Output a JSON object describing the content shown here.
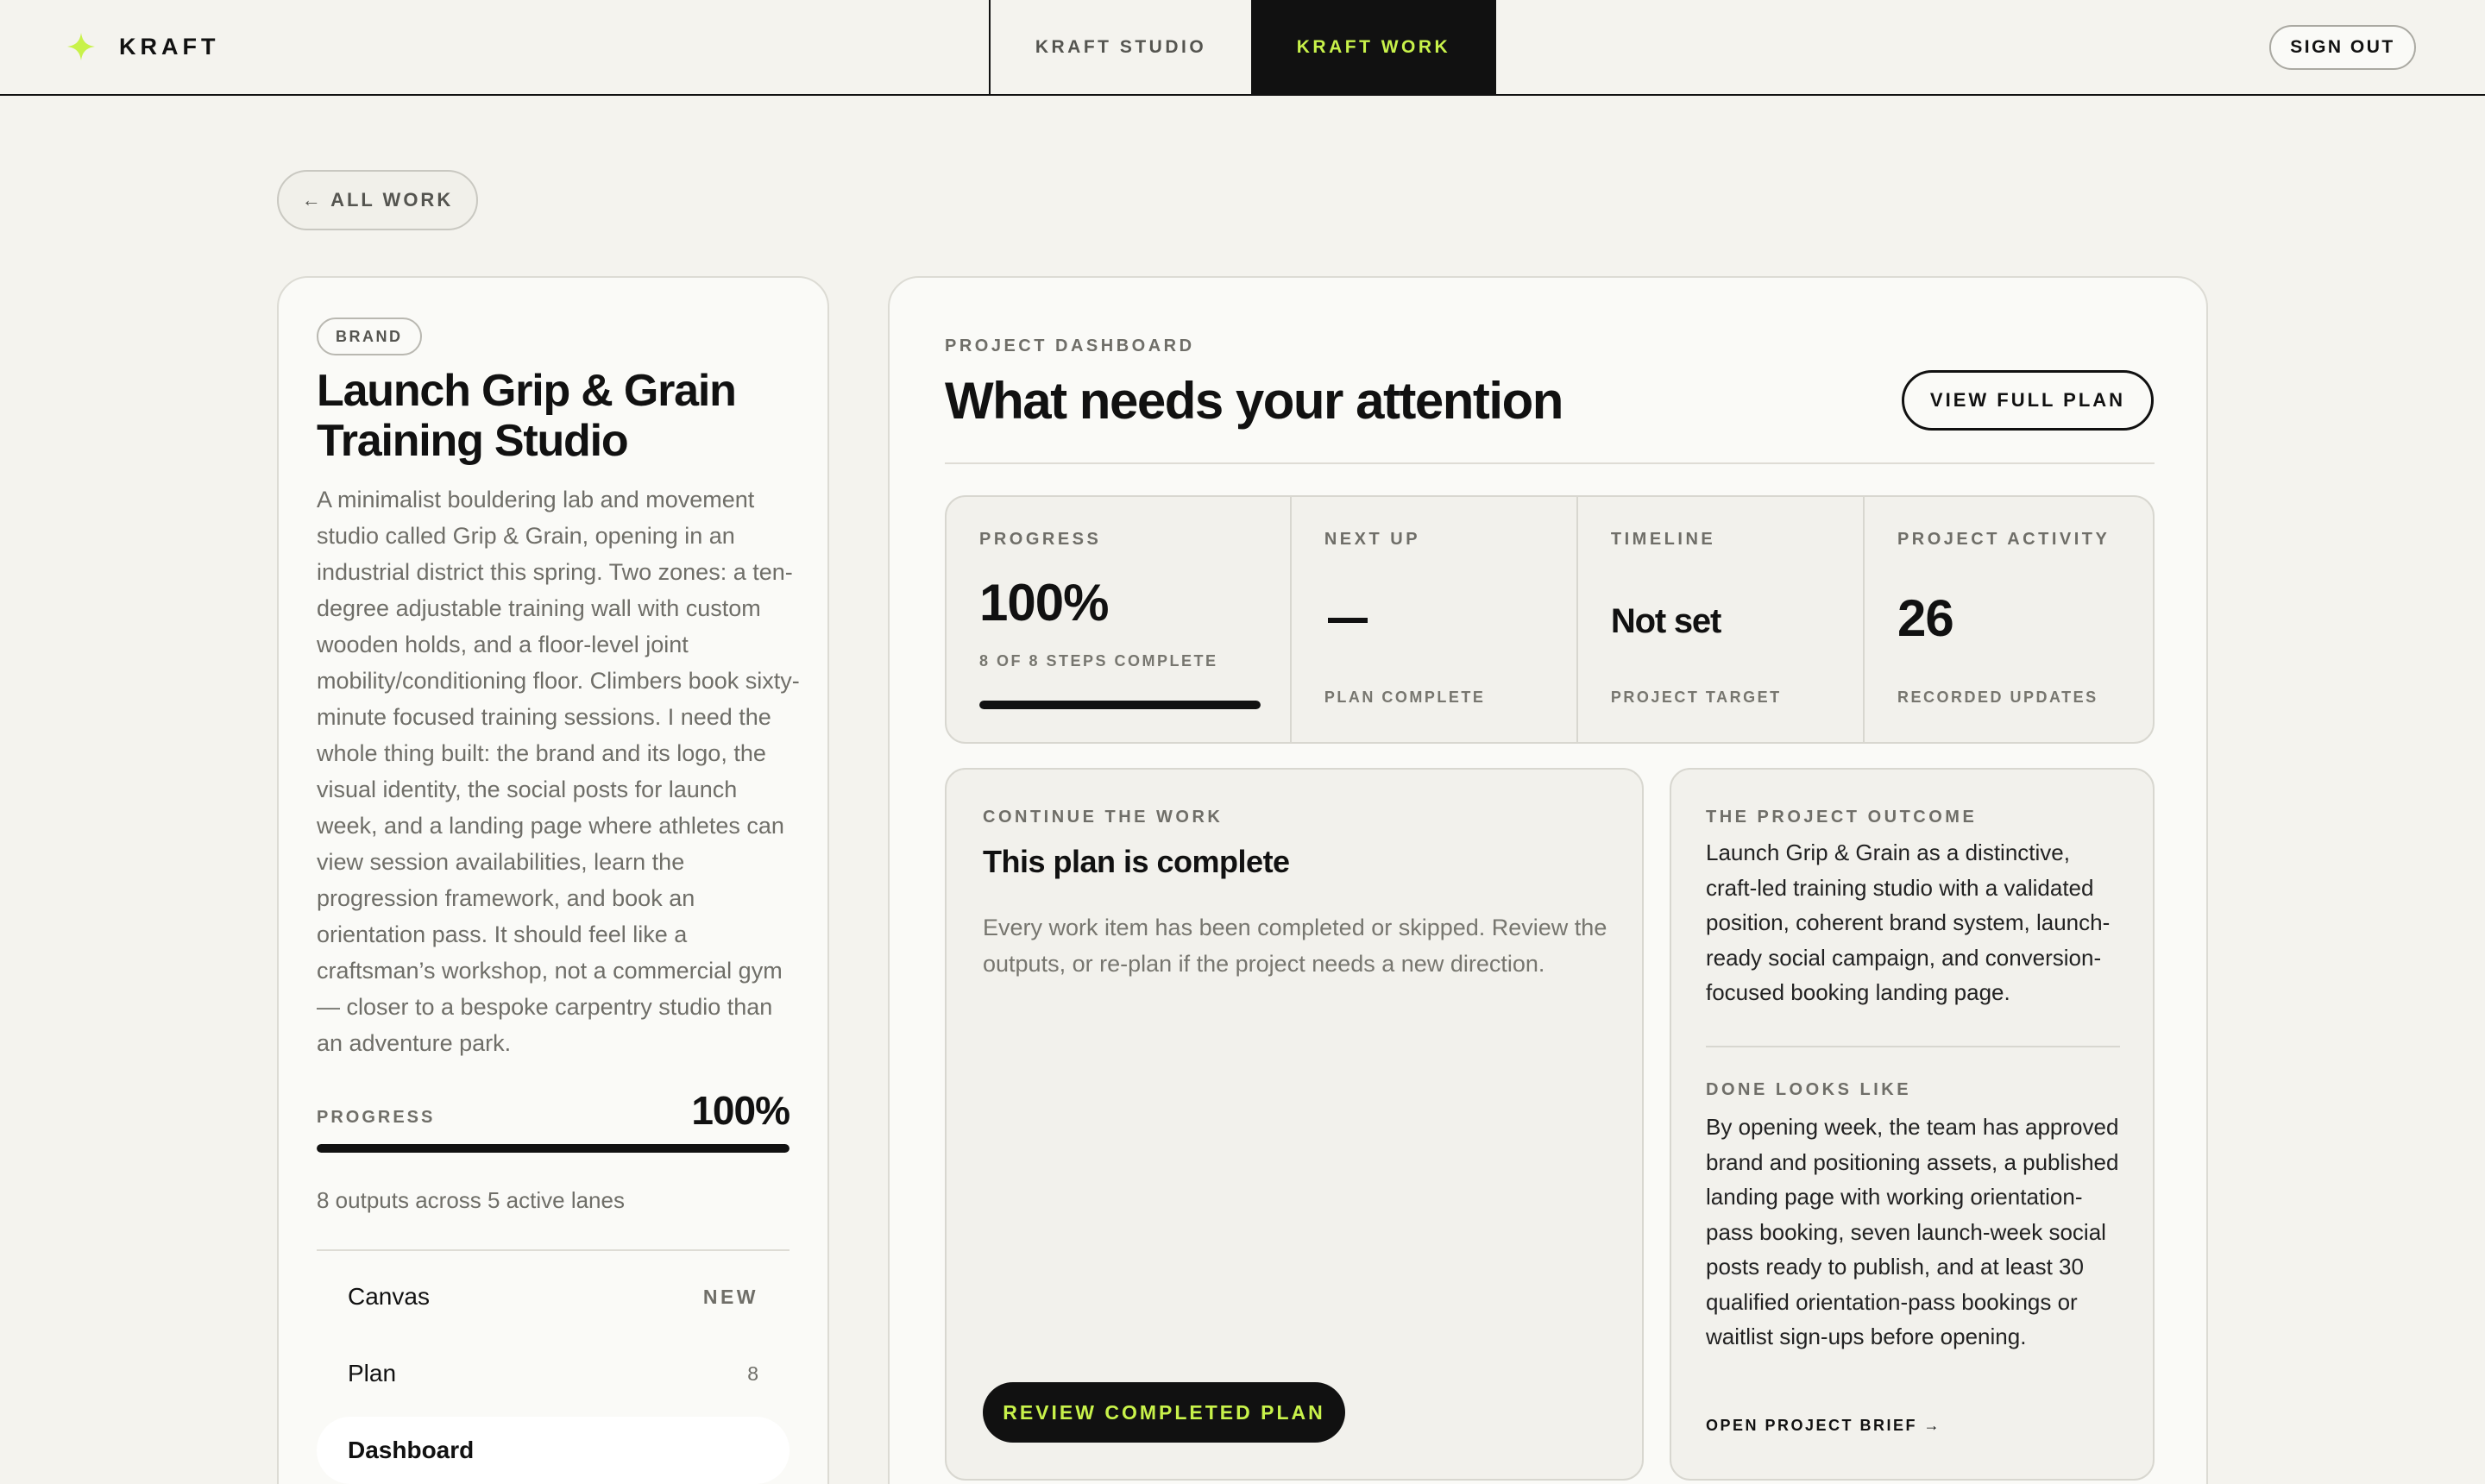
{
  "header": {
    "brand_name": "KRAFT",
    "nav": {
      "studio": "KRAFT STUDIO",
      "work": "KRAFT WORK"
    },
    "sign_out": "SIGN OUT",
    "accent_color": "#c8f24a"
  },
  "back_button": "← ALL WORK",
  "project": {
    "tag": "BRAND",
    "title": "Launch Grip & Grain Training Studio",
    "description": "A minimalist bouldering lab and movement studio called Grip & Grain, opening in an industrial district this spring. Two zones: a ten-degree adjustable training wall with custom wooden holds, and a floor-level joint mobility/conditioning floor. Climbers book sixty-minute focused training sessions. I need the whole thing built: the brand and its logo, the visual identity, the social posts for launch week, and a landing page where athletes can view session availabilities, learn the progression framework, and book an orientation pass. It should feel like a craftsman’s workshop, not a commercial gym — closer to a bespoke carpentry studio than an adventure park.",
    "progress_label": "PROGRESS",
    "progress_text": "100%",
    "progress_fraction": 1.0,
    "outputs_summary": "8 outputs across 5 active lanes",
    "lanes": [
      {
        "label": "Canvas",
        "meta": "NEW"
      },
      {
        "label": "Plan",
        "meta": "8"
      },
      {
        "label": "Dashboard",
        "meta": ""
      }
    ]
  },
  "dashboard": {
    "eyebrow": "PROJECT DASHBOARD",
    "title": "What needs your attention",
    "view_plan_button": "VIEW FULL PLAN",
    "stats": {
      "progress": {
        "label": "PROGRESS",
        "value": "100%",
        "sub": "8 OF 8 STEPS COMPLETE",
        "fraction": 1.0
      },
      "next_up": {
        "label": "NEXT UP",
        "sub": "PLAN COMPLETE"
      },
      "timeline": {
        "label": "TIMELINE",
        "value": "Not set",
        "sub": "PROJECT TARGET"
      },
      "activity": {
        "label": "PROJECT ACTIVITY",
        "value": "26",
        "sub": "RECORDED UPDATES"
      }
    },
    "continue": {
      "eyebrow": "CONTINUE THE WORK",
      "title": "This plan is complete",
      "description": "Every work item has been completed or skipped. Review the outputs, or re-plan if the project needs a new direction.",
      "button": "REVIEW COMPLETED PLAN"
    },
    "outcome": {
      "eyebrow": "THE PROJECT OUTCOME",
      "text": "Launch Grip & Grain as a distinctive, craft-led training studio with a validated position, coherent brand system, launch-ready social campaign, and conversion-focused booking landing page.",
      "done_eyebrow": "DONE LOOKS LIKE",
      "done_text": "By opening week, the team has approved brand and positioning assets, a published landing page with working orientation-pass booking, seven launch-week social posts ready to publish, and at least 30 qualified orientation-pass bookings or waitlist sign-ups before opening.",
      "brief_link": "OPEN PROJECT BRIEF →"
    }
  }
}
